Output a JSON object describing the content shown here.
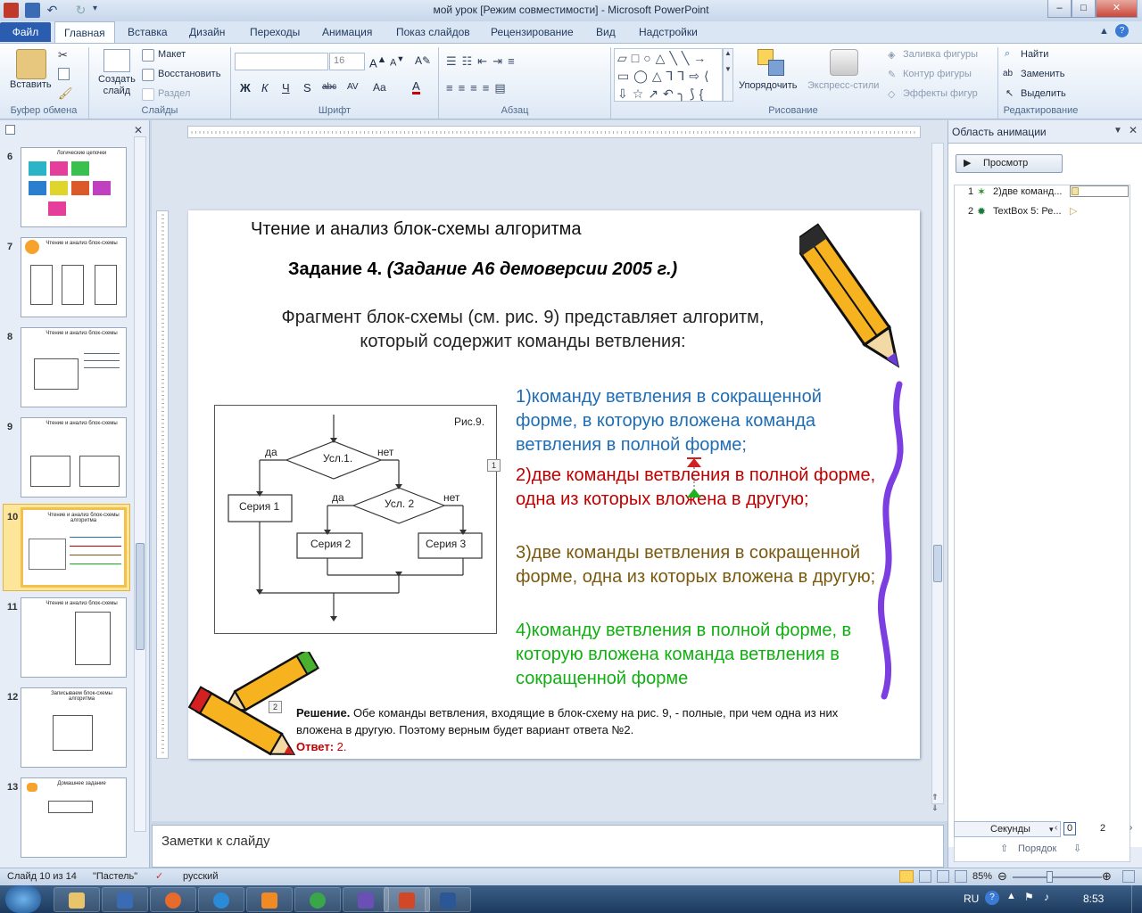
{
  "window": {
    "title": "мой урок [Режим совместимости] - Microsoft PowerPoint"
  },
  "tabs": {
    "file": "Файл",
    "items": [
      "Главная",
      "Вставка",
      "Дизайн",
      "Переходы",
      "Анимация",
      "Показ слайдов",
      "Рецензирование",
      "Вид",
      "Надстройки"
    ],
    "active": "Главная"
  },
  "ribbon": {
    "clipboard": {
      "paste": "Вставить",
      "label": "Буфер обмена"
    },
    "slides": {
      "create": "Создать\nслайд",
      "layout": "Макет",
      "reset": "Восстановить",
      "section": "Раздел",
      "label": "Слайды"
    },
    "font": {
      "size": "16",
      "label": "Шрифт",
      "buttons": [
        "Ж",
        "К",
        "Ч",
        "S",
        "abc",
        "AV",
        "Aa",
        "A"
      ]
    },
    "paragraph": {
      "label": "Абзац"
    },
    "drawing": {
      "arrange": "Упорядочить",
      "quick_styles": "Экспресс-стили",
      "fill": "Заливка фигуры",
      "outline": "Контур фигуры",
      "effects": "Эффекты фигур",
      "label": "Рисование"
    },
    "editing": {
      "find": "Найти",
      "replace": "Заменить",
      "select": "Выделить",
      "label": "Редактирование"
    }
  },
  "slides_pane": {
    "thumbnails": [
      {
        "num": "6",
        "title": "Логические цепочки"
      },
      {
        "num": "7",
        "title": "Чтение и анализ блок-схемы"
      },
      {
        "num": "8",
        "title": "Чтение и анализ блок-схемы"
      },
      {
        "num": "9",
        "title": "Чтение и анализ блок-схемы"
      },
      {
        "num": "10",
        "title": "Чтение и анализ блок-схемы алгоритма",
        "selected": true
      },
      {
        "num": "11",
        "title": "Чтение и анализ блок-схемы"
      },
      {
        "num": "12",
        "title": "Записываем блок-схемы алгоритма"
      },
      {
        "num": "13",
        "title": "Домашнее задание"
      }
    ]
  },
  "slide": {
    "title": "Чтение и анализ  блок-схемы алгоритма",
    "task_bold": "Задание 4. ",
    "task_italic": "(Задание А6 демоверсии 2005 г.)",
    "intro": "Фрагмент блок-схемы (см. рис. 9) представляет алгоритм, который содержит команды ветвления:",
    "options": [
      {
        "text": "1)команду ветвления в сокращенной форме, в которую вложена команда ветвления в  полной форме;",
        "color": "#1f6db5"
      },
      {
        "text": "2)две команды ветвления в полной форме, одна из которых вложена в другую;",
        "color": "#c00000"
      },
      {
        "text": "3)две команды ветвления в сокращенной форме, одна из которых вложена в другую;",
        "color": "#7a5a10"
      },
      {
        "text": "4)команду ветвления в полной форме, в которую вложена команда ветвления в сокращенной форме",
        "color": "#10b010"
      }
    ],
    "flowchart": {
      "caption": "Рис.9.",
      "cond1": "Усл.1.",
      "cond2": "Усл. 2",
      "yes": "да",
      "no": "нет",
      "series1": "Серия 1",
      "series2": "Серия 2",
      "series3": "Серия 3"
    },
    "solution_label": "Решение.",
    "solution_text": " Обе команды ветвления, входящие в блок-схему на рис. 9, - полные, при чем одна из них вложена в другую. Поэтому верным будет вариант ответа №2.",
    "answer_label": "Ответ:",
    "answer_value": " 2.",
    "anim_tags": [
      "1",
      "2"
    ]
  },
  "notes": {
    "placeholder": "Заметки к слайду"
  },
  "anim_pane": {
    "title": "Область анимации",
    "play": "Просмотр",
    "items": [
      {
        "num": "1",
        "label": "2)две команд..."
      },
      {
        "num": "2",
        "label": "TextBox 5: Ре..."
      }
    ],
    "seconds": "Секунды",
    "time_start": "0",
    "time_end": "2",
    "reorder": "Порядок"
  },
  "status": {
    "slide": "Слайд 10 из 14",
    "theme": "\"Пастель\"",
    "language": "русский",
    "zoom": "85%"
  },
  "taskbar": {
    "lang": "RU",
    "time": "8:53"
  },
  "colors": {
    "ribbon_bg": "#dde8f5",
    "file_tab": "#2a5db0",
    "selected_thumb": "#f4c04c",
    "option_1": "#1f6db5",
    "option_2": "#c00000",
    "option_3": "#7a5a10",
    "option_4": "#10b010"
  }
}
